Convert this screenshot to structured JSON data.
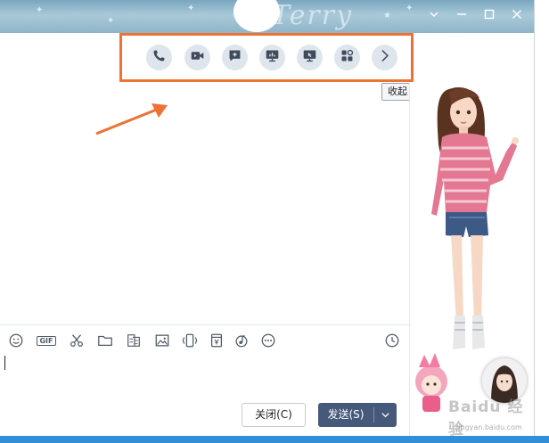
{
  "window": {
    "banner_word": "Terry",
    "controls": {
      "chevron": "chevron-down-icon",
      "minimize": "minimize-icon",
      "maximize": "maximize-icon",
      "close": "close-icon"
    }
  },
  "toolbar": {
    "buttons": [
      {
        "name": "voice-call",
        "icon": "phone-icon"
      },
      {
        "name": "video-call",
        "icon": "video-icon"
      },
      {
        "name": "new-chat",
        "icon": "chat-plus-icon"
      },
      {
        "name": "screen-share",
        "icon": "presentation-icon"
      },
      {
        "name": "remote-assist",
        "icon": "remote-screen-icon"
      },
      {
        "name": "apps",
        "icon": "apps-icon"
      },
      {
        "name": "expand-more",
        "icon": "chevron-right-icon"
      }
    ],
    "collapse_tooltip": "收起",
    "accent_color": "#ed7234"
  },
  "input_toolbar": {
    "gif_label": "GIF",
    "icons": [
      "emoji-icon",
      "gif-icon",
      "scissors-icon",
      "folder-icon",
      "font-icon",
      "image-icon",
      "shake-icon",
      "red-packet-icon",
      "music-icon",
      "more-icon",
      "history-clock-icon"
    ]
  },
  "actions": {
    "close_label": "关闭(C)",
    "send_label": "发送(S)",
    "send_color": "#46597a"
  },
  "watermark": {
    "text": "Baidu 经验",
    "url": "jingyan.baidu.com"
  }
}
